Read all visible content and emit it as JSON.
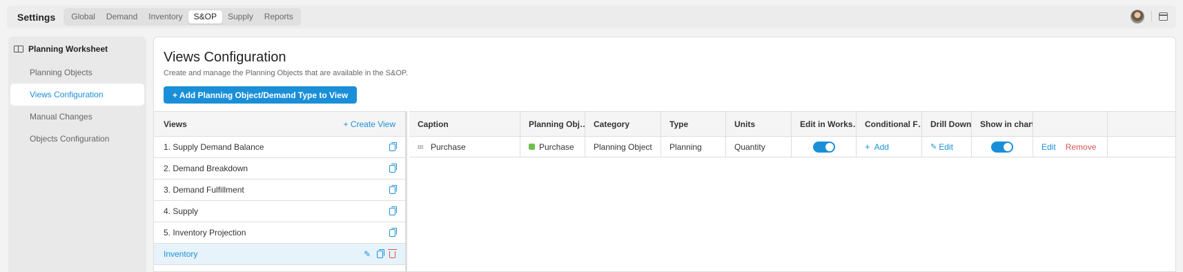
{
  "app": {
    "title": "Settings"
  },
  "nav": {
    "tabs": [
      {
        "label": "Global"
      },
      {
        "label": "Demand"
      },
      {
        "label": "Inventory"
      },
      {
        "label": "S&OP",
        "active": true
      },
      {
        "label": "Supply"
      },
      {
        "label": "Reports"
      }
    ]
  },
  "sidebar": {
    "header": "Planning Worksheet",
    "items": [
      {
        "label": "Planning Objects"
      },
      {
        "label": "Views Configuration",
        "active": true
      },
      {
        "label": "Manual Changes"
      },
      {
        "label": "Objects Configuration"
      }
    ]
  },
  "main": {
    "title": "Views Configuration",
    "subtitle": "Create and manage the Planning Objects that are available in the S&OP.",
    "add_button": "+ Add Planning Object/Demand Type to View"
  },
  "views": {
    "header": "Views",
    "create_link": "+ Create View",
    "items": [
      {
        "label": "1. Supply Demand Balance"
      },
      {
        "label": "2. Demand Breakdown"
      },
      {
        "label": "3. Demand Fulfillment"
      },
      {
        "label": "4. Supply"
      },
      {
        "label": "5. Inventory Projection"
      },
      {
        "label": "Inventory",
        "selected": true
      }
    ]
  },
  "grid": {
    "columns": [
      "Caption",
      "Planning Obj…",
      "Category",
      "Type",
      "Units",
      "Edit in Works…",
      "Conditional F…",
      "Drill Down",
      "Show in chart",
      ""
    ],
    "rows": [
      {
        "caption": "Purchase",
        "planning_object": "Purchase",
        "planning_object_color": "#6fbf4a",
        "category": "Planning Object",
        "type": "Planning",
        "units": "Quantity",
        "edit_in_worksheet": true,
        "conditional_format": "Add",
        "drill_down": "Edit",
        "show_in_chart": true,
        "edit_action": "Edit",
        "remove_action": "Remove"
      }
    ]
  },
  "colors": {
    "accent": "#1a8fd8",
    "danger": "#d9534f"
  }
}
